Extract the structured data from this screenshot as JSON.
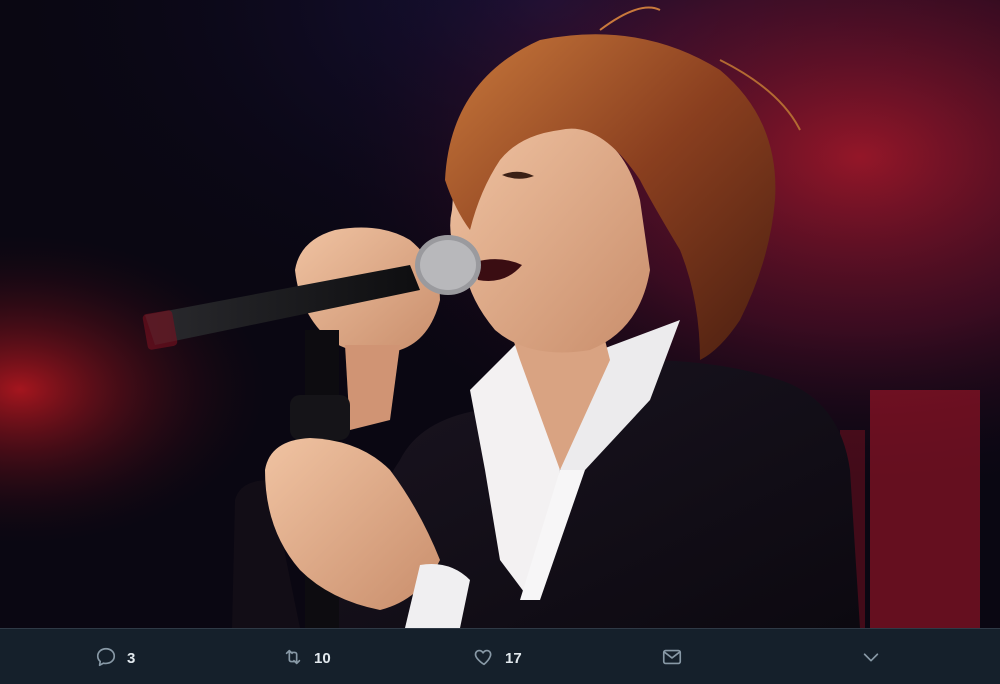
{
  "media": {
    "photo_description_icon": "concert-photo"
  },
  "actions": {
    "reply_count": "3",
    "retweet_count": "10",
    "like_count": "17",
    "reply_icon": "reply-icon",
    "retweet_icon": "retweet-icon",
    "like_icon": "heart-icon",
    "share_icon": "mail-icon",
    "more_icon": "chevron-down-icon"
  },
  "colors": {
    "bar_background": "#15202b",
    "icon_color": "#8899a6",
    "count_color": "#e1e8ed"
  }
}
